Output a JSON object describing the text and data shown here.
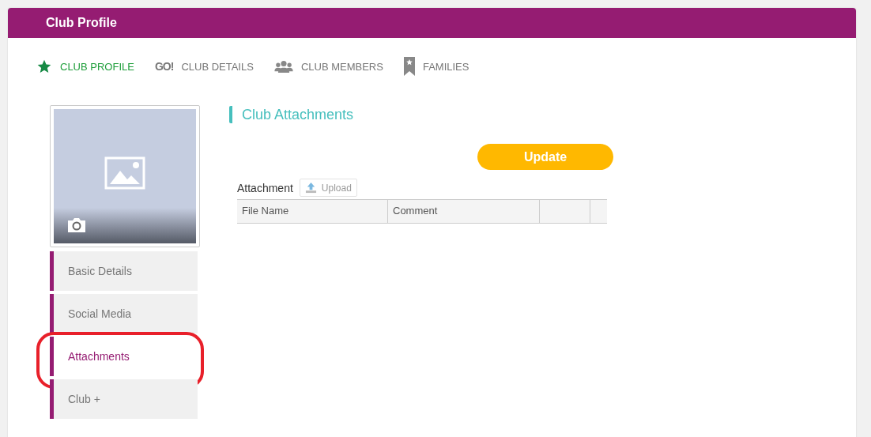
{
  "header": {
    "title": "Club Profile"
  },
  "tabs": [
    {
      "label": "CLUB PROFILE",
      "kind": "star",
      "selected": true
    },
    {
      "label": "CLUB DETAILS",
      "kind": "logo",
      "icon_text": "GO!",
      "selected": false
    },
    {
      "label": "CLUB MEMBERS",
      "kind": "people",
      "selected": false
    },
    {
      "label": "FAMILIES",
      "kind": "bookmark",
      "selected": false
    }
  ],
  "sidebar": {
    "items": [
      {
        "label": "Basic Details",
        "selected": false,
        "annotated": false
      },
      {
        "label": "Social Media",
        "selected": false,
        "annotated": false
      },
      {
        "label": "Attachments",
        "selected": true,
        "annotated": true
      },
      {
        "label": "Club +",
        "selected": false,
        "annotated": false
      }
    ]
  },
  "section": {
    "title": "Club Attachments",
    "update_button": "Update",
    "attachment_label": "Attachment",
    "upload_button": "Upload",
    "table": {
      "columns": [
        "File Name",
        "Comment"
      ]
    }
  }
}
